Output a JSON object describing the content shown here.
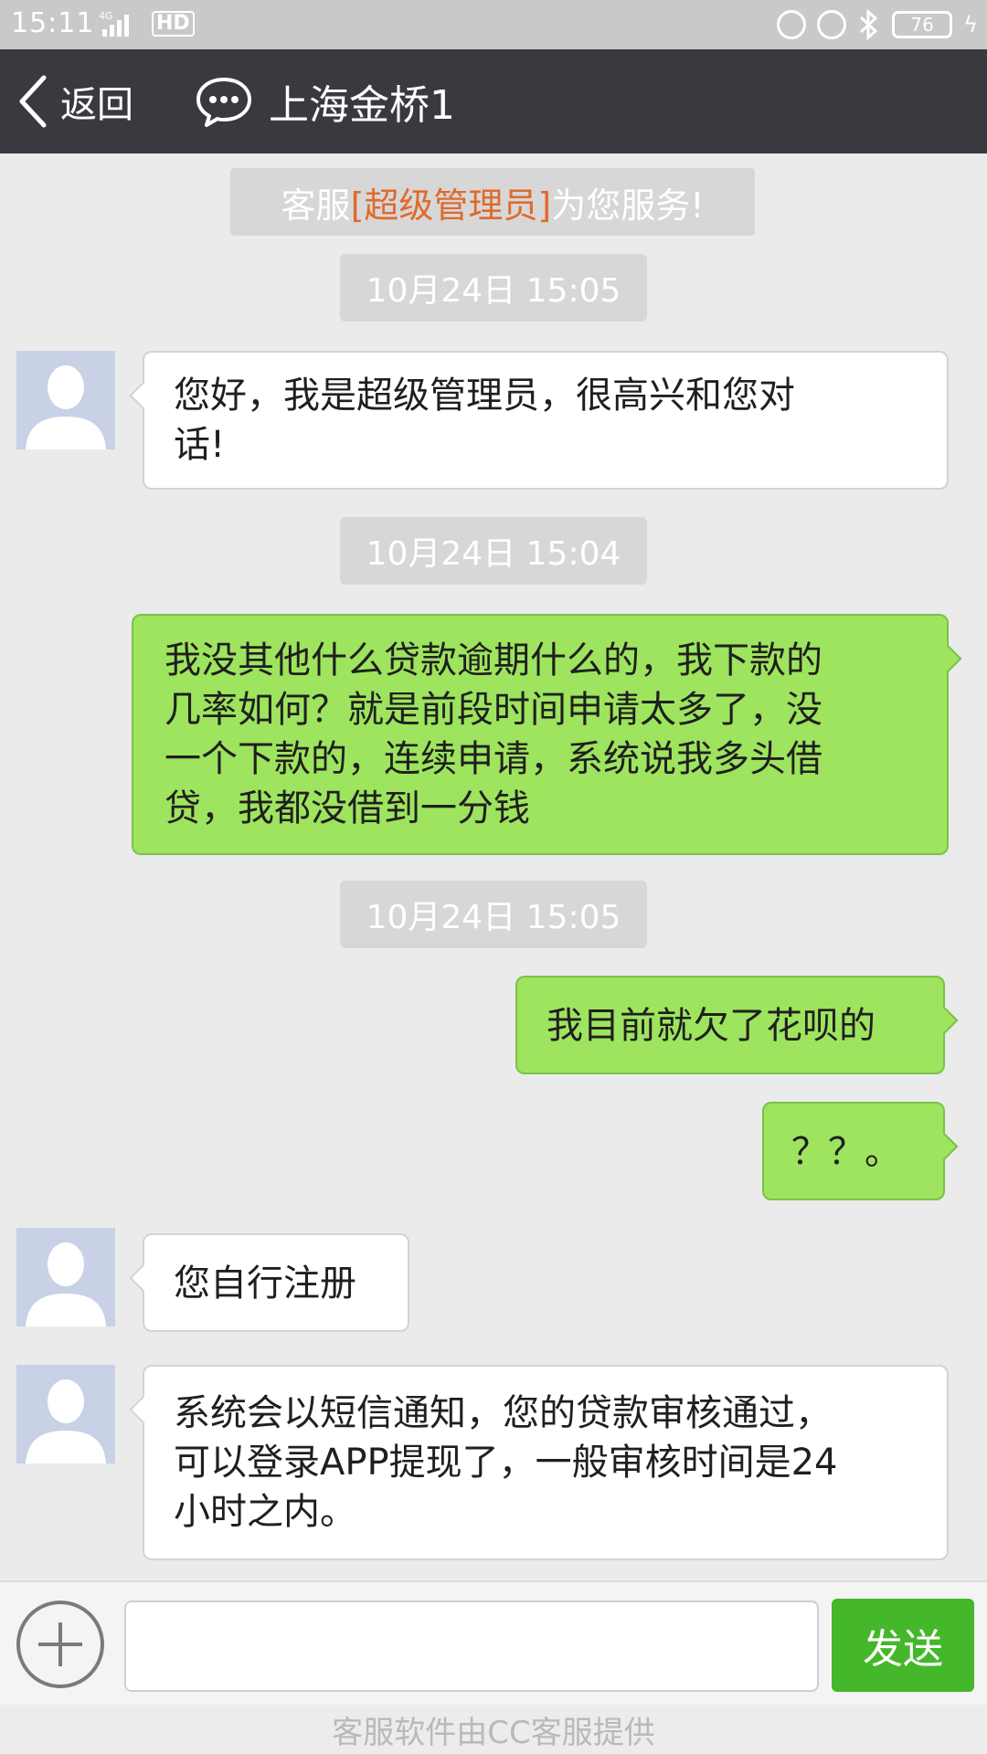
{
  "status_bar": {
    "time": "15:11",
    "network": "4G",
    "hd": "HD",
    "battery": "76"
  },
  "header": {
    "back_label": "返回",
    "title": "上海金桥1"
  },
  "notice": {
    "prefix": "客服",
    "highlight": "[超级管理员]",
    "suffix": "为您服务!"
  },
  "messages": [
    {
      "type": "timestamp",
      "text": "10月24日 15:05"
    },
    {
      "type": "received",
      "lines": [
        "您好，我是超级管理员，很高兴和您对",
        "话!"
      ]
    },
    {
      "type": "timestamp",
      "text": "10月24日 15:04"
    },
    {
      "type": "sent",
      "lines": [
        "我没其他什么贷款逾期什么的，我下款的",
        "几率如何？就是前段时间申请太多了，没",
        "一个下款的，连续申请，系统说我多头借",
        "贷，我都没借到一分钱"
      ]
    },
    {
      "type": "timestamp",
      "text": "10月24日 15:05"
    },
    {
      "type": "sent",
      "lines": [
        "我目前就欠了花呗的"
      ]
    },
    {
      "type": "sent",
      "lines": [
        "？？。"
      ]
    },
    {
      "type": "received",
      "lines": [
        "您自行注册"
      ]
    },
    {
      "type": "received",
      "lines": [
        "系统会以短信通知，您的贷款审核通过，",
        "可以登录APP提现了，一般审核时间是24",
        "小时之内。"
      ]
    }
  ],
  "input": {
    "value": "",
    "send_label": "发送"
  },
  "footer": "客服软件由CC客服提供",
  "colors": {
    "header_bg": "#393a3f",
    "sent_bubble": "#9ee45e",
    "received_bubble": "#ffffff",
    "send_button": "#44b72a",
    "notice_highlight": "#e06a2c"
  }
}
